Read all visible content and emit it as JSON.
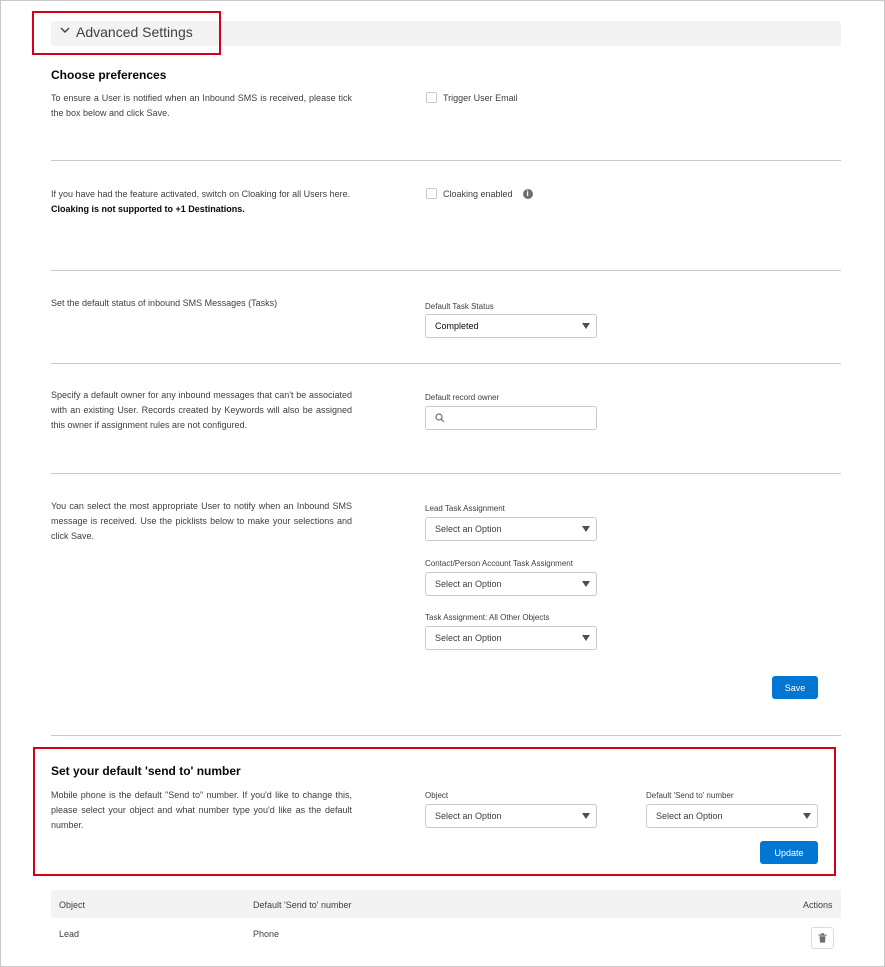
{
  "advanced_settings": {
    "title": "Advanced Settings"
  },
  "preferences": {
    "title": "Choose preferences",
    "trigger_desc": "To ensure a User is notified when an Inbound SMS is received, please tick the box below and click Save.",
    "trigger_label": "Trigger User Email",
    "cloaking_desc": "If you have had the feature activated, switch on Cloaking for all Users here.",
    "cloaking_note": "Cloaking is not supported to +1 Destinations.",
    "cloaking_label": "Cloaking enabled",
    "task_status_desc": "Set the default status of inbound SMS Messages (Tasks)",
    "task_status_label": "Default Task Status",
    "task_status_value": "Completed",
    "owner_desc": "Specify a default owner for any inbound messages that can't be associated with an existing User. Records created by Keywords will also be assigned this owner if assignment rules are not configured.",
    "owner_label": "Default record owner",
    "assignment_desc": "You can select the most appropriate User to notify when an Inbound SMS message is received. Use the picklists below to make your selections and click Save.",
    "lead_label": "Lead Task Assignment",
    "lead_value": "Select an Option",
    "contact_label": "Contact/Person Account Task Assignment",
    "contact_value": "Select an Option",
    "other_label": "Task Assignment: All Other Objects",
    "other_value": "Select an Option",
    "save_label": "Save"
  },
  "send_to": {
    "title": "Set your default 'send to' number",
    "desc": "Mobile phone is the default \"Send to\" number. If you'd like to change this, please select your object and what number type you'd like as the default number.",
    "object_label": "Object",
    "object_value": "Select an Option",
    "number_label": "Default 'Send to' number",
    "number_value": "Select an Option",
    "update_label": "Update"
  },
  "table": {
    "headers": [
      "Object",
      "Default 'Send to' number",
      "Actions"
    ],
    "rows": [
      {
        "object": "Lead",
        "number": "Phone"
      }
    ]
  },
  "icons": {
    "chevron": "chevron-down-icon",
    "info": "info-icon",
    "search": "search-icon",
    "delete": "trash-icon",
    "dropdown": "caret-down-icon"
  },
  "colors": {
    "brand_button": "#0176d3",
    "highlight_box": "#d4001a"
  }
}
